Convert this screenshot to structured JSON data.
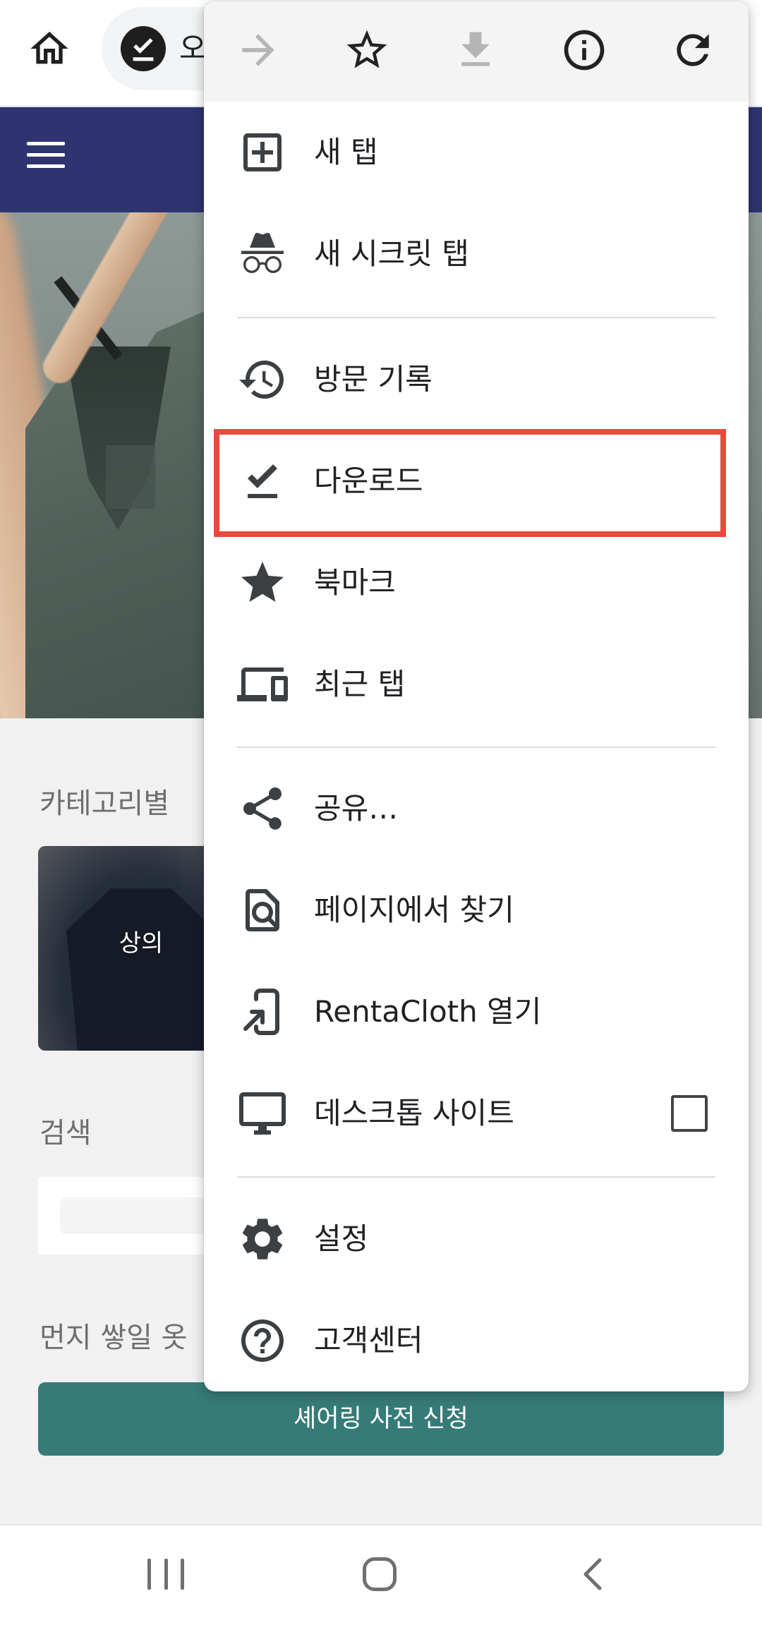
{
  "browser": {
    "url_text": "오",
    "icons": {
      "home": "home-icon",
      "site": "check-circle-icon"
    }
  },
  "site": {
    "header": {
      "menu_icon": "hamburger-icon",
      "color": "#2d3470"
    },
    "categories": {
      "heading": "카테고리별",
      "cards": [
        {
          "label": "상의"
        }
      ]
    },
    "search": {
      "heading": "검색"
    },
    "share_section": {
      "heading": "먼지 쌓일 옷",
      "button_label": "셰어링 사전 신청",
      "button_color": "#367b78"
    }
  },
  "menu": {
    "toolbar": [
      {
        "icon": "forward-arrow-icon",
        "enabled": false
      },
      {
        "icon": "star-outline-icon",
        "enabled": true
      },
      {
        "icon": "download-icon",
        "enabled": false
      },
      {
        "icon": "info-icon",
        "enabled": true
      },
      {
        "icon": "refresh-icon",
        "enabled": true
      }
    ],
    "items": [
      {
        "label": "새 탭",
        "icon": "new-tab-icon"
      },
      {
        "label": "새 시크릿 탭",
        "icon": "incognito-icon"
      },
      {
        "label": "방문 기록",
        "icon": "history-icon"
      },
      {
        "label": "다운로드",
        "icon": "download-done-icon"
      },
      {
        "label": "북마크",
        "icon": "star-icon"
      },
      {
        "label": "최근 탭",
        "icon": "devices-icon"
      },
      {
        "label": "공유…",
        "icon": "share-icon"
      },
      {
        "label": "페이지에서 찾기",
        "icon": "find-in-page-icon"
      },
      {
        "label": "RentaCloth 열기",
        "icon": "open-in-app-icon"
      },
      {
        "label": "데스크톱 사이트",
        "icon": "desktop-icon"
      },
      {
        "label": "설정",
        "icon": "settings-icon"
      },
      {
        "label": "고객센터",
        "icon": "help-icon"
      }
    ],
    "desktop_site_checked": false
  },
  "annotation": {
    "highlighted_item_index": 3,
    "color": "#e84a3b"
  },
  "system_nav": {
    "recent": "recent-apps-icon",
    "home": "nav-home-icon",
    "back": "back-icon"
  }
}
